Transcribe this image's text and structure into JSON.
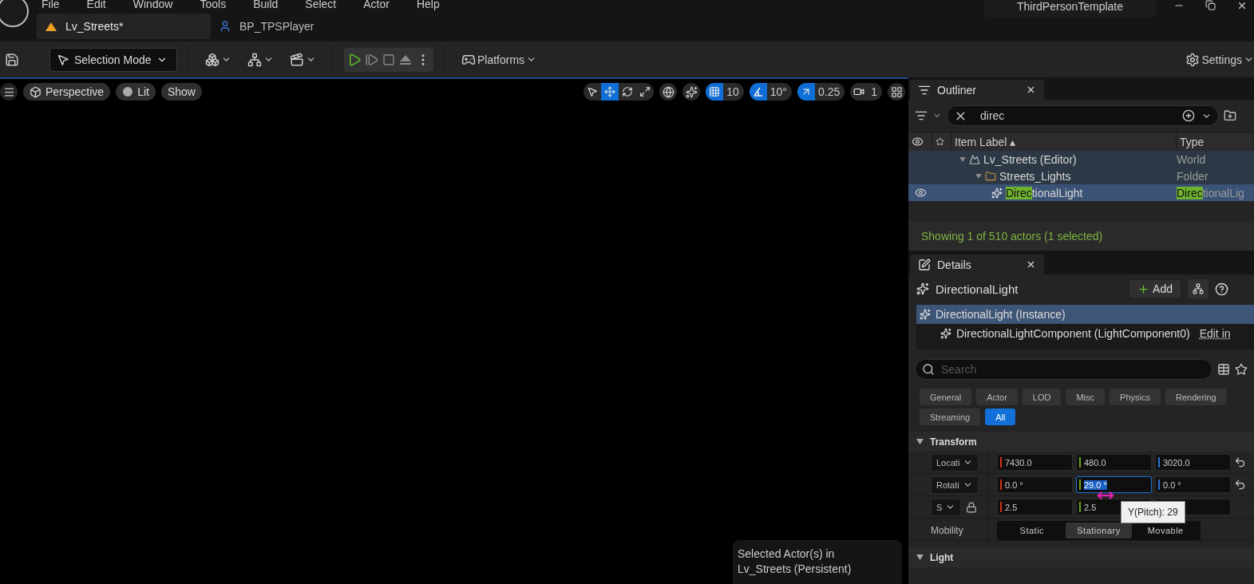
{
  "menu": [
    "File",
    "Edit",
    "Window",
    "Tools",
    "Build",
    "Select",
    "Actor",
    "Help"
  ],
  "window": {
    "project": "ThirdPersonTemplate"
  },
  "tabs": [
    {
      "label": "Lv_Streets*",
      "selected": true,
      "kind": "level"
    },
    {
      "label": "BP_TPSPlayer",
      "selected": false,
      "kind": "blueprint"
    }
  ],
  "toolbar": {
    "mode": "Selection Mode",
    "platforms": "Platforms",
    "settings": "Settings"
  },
  "viewport": {
    "menu_buttons": [
      {
        "label": "Perspective",
        "kind": "perspective"
      },
      {
        "label": "Lit",
        "kind": "lit"
      },
      {
        "label": "Show",
        "kind": "show"
      }
    ],
    "transform_tools": [
      {
        "kind": "select",
        "selected": false
      },
      {
        "kind": "move",
        "selected": true
      },
      {
        "kind": "rotate",
        "selected": false
      },
      {
        "kind": "scale",
        "selected": false
      }
    ],
    "snaps": [
      {
        "kind": "grid",
        "value": "10",
        "on": true
      },
      {
        "kind": "angle",
        "value": "10°",
        "on": true
      },
      {
        "kind": "scale",
        "value": "0.25",
        "on": true
      },
      {
        "kind": "camera",
        "value": "1",
        "on": false
      }
    ],
    "info": [
      "Selected Actor(s) in",
      "Lv_Streets (Persistent)"
    ]
  },
  "outliner": {
    "title": "Outliner",
    "search": "direc",
    "columns": [
      {
        "label": "Item Label",
        "sort": "▴"
      },
      {
        "label": "Type"
      }
    ],
    "rows": [
      {
        "label": [
          {
            "text": "Lv_Streets (Editor)",
            "highlight": false
          }
        ],
        "type": [
          {
            "text": "World",
            "highlight": false
          }
        ],
        "kind": "world",
        "selected": false,
        "children": [
          {
            "label": [
              {
                "text": "Streets_Lights",
                "highlight": false
              }
            ],
            "type": [
              {
                "text": "Folder",
                "highlight": false
              }
            ],
            "kind": "folder",
            "selected": false,
            "children": [
              {
                "label": [
                  {
                    "text": "Direc",
                    "highlight": true
                  },
                  {
                    "text": "tionalLight",
                    "highlight": false
                  }
                ],
                "type": [
                  {
                    "text": "Direc",
                    "highlight": true
                  },
                  {
                    "text": "tionalLig",
                    "highlight": false
                  }
                ],
                "kind": "light",
                "selected": true,
                "visible": true
              }
            ]
          }
        ]
      }
    ],
    "status": "Showing 1 of 510 actors (1 selected)"
  },
  "details": {
    "title": "Details",
    "actor": "DirectionalLight",
    "add": "Add",
    "components": [
      {
        "label": "DirectionalLight (Instance)",
        "selected": true
      },
      {
        "label": "DirectionalLightComponent (LightComponent0)",
        "selected": false,
        "link": "Edit in"
      }
    ],
    "search_placeholder": "Search",
    "filters": [
      {
        "label": "General",
        "selected": false
      },
      {
        "label": "Actor",
        "selected": false
      },
      {
        "label": "LOD",
        "selected": false
      },
      {
        "label": "Misc",
        "selected": false
      },
      {
        "label": "Physics",
        "selected": false
      },
      {
        "label": "Rendering",
        "selected": false
      },
      {
        "label": "Streaming",
        "selected": false
      },
      {
        "label": "All",
        "selected": true
      }
    ],
    "sections": [
      {
        "title": "Transform",
        "expanded": true,
        "rows": [
          {
            "kind": "vector",
            "label": "Locati",
            "resettable": true,
            "locked": false,
            "values": [
              {
                "value": "7430.0",
                "editing": false
              },
              {
                "value": "480.0",
                "editing": false
              },
              {
                "value": "3020.0",
                "editing": false
              }
            ]
          },
          {
            "kind": "vector",
            "label": "Rotati",
            "resettable": true,
            "locked": false,
            "values": [
              {
                "value": "0.0 °",
                "editing": false
              },
              {
                "value": "29.0 °",
                "editing": true
              },
              {
                "value": "0.0 °",
                "editing": false
              }
            ]
          },
          {
            "kind": "vector",
            "label": "S",
            "resettable": false,
            "locked": true,
            "values": [
              {
                "value": "2.5",
                "editing": false
              },
              {
                "value": "2.5",
                "editing": false
              }
            ]
          },
          {
            "kind": "choice",
            "label": "Mobility",
            "options": [
              {
                "label": "Static",
                "selected": false
              },
              {
                "label": "Stationary",
                "selected": true
              },
              {
                "label": "Movable",
                "selected": false
              }
            ]
          }
        ]
      },
      {
        "title": "Light",
        "expanded": true
      }
    ],
    "tooltip": "Y(Pitch): 29"
  }
}
